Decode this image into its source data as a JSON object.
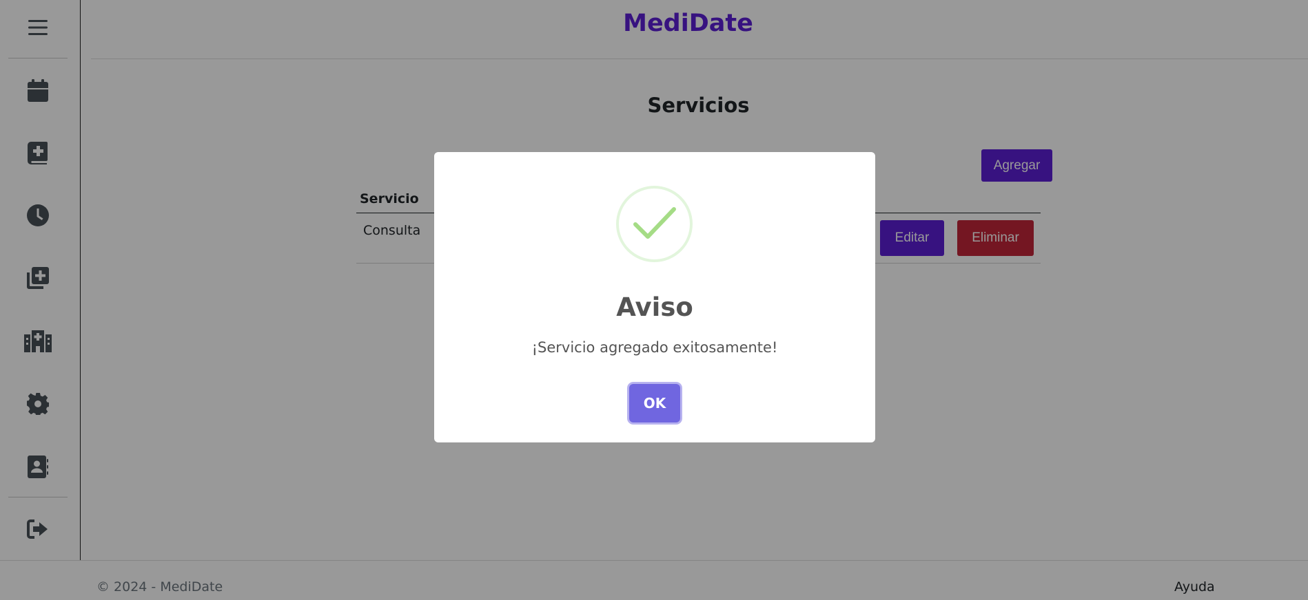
{
  "header": {
    "brand": "MediDate"
  },
  "sidebar": {
    "items": [
      {
        "name": "menu",
        "icon": "hamburger-icon"
      },
      {
        "name": "calendar",
        "icon": "calendar-icon"
      },
      {
        "name": "medical-book",
        "icon": "book-medical-icon"
      },
      {
        "name": "schedule",
        "icon": "clock-icon"
      },
      {
        "name": "services",
        "icon": "copy-plus-icon"
      },
      {
        "name": "hospital",
        "icon": "hospital-icon"
      },
      {
        "name": "settings",
        "icon": "gear-icon"
      },
      {
        "name": "contacts",
        "icon": "address-book-icon"
      },
      {
        "name": "logout",
        "icon": "sign-out-icon"
      }
    ]
  },
  "main": {
    "title": "Servicios",
    "add_label": "Agregar",
    "table": {
      "headers": [
        "Servicio"
      ],
      "rows": [
        {
          "servicio": "Consulta",
          "edit_label": "Editar",
          "delete_label": "Eliminar"
        }
      ]
    }
  },
  "footer": {
    "copyright": "© 2024 - MediDate",
    "help": "Ayuda"
  },
  "modal": {
    "icon": "success-check-icon",
    "title": "Aviso",
    "message": "¡Servicio agregado exitosamente!",
    "ok_label": "OK"
  },
  "colors": {
    "brand": "#5c1fd6",
    "danger": "#c1263a",
    "ok": "#7066e0",
    "success": "#a5dc86"
  }
}
